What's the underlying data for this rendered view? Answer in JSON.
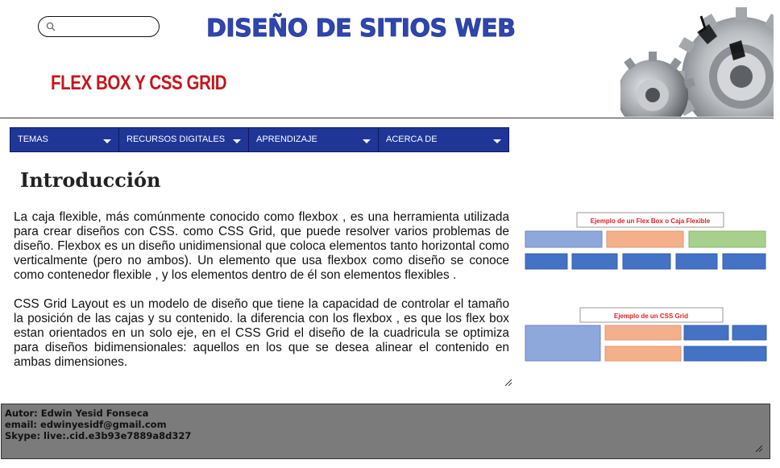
{
  "header": {
    "search": {
      "placeholder": ""
    },
    "site_title": "DISEÑO DE SITIOS WEB",
    "subtitle": "FLEX BOX Y CSS GRID",
    "banner_image": "gears-image"
  },
  "nav": {
    "items": [
      {
        "label": "TEMAS"
      },
      {
        "label": "RECURSOS DIGITALES"
      },
      {
        "label": "APRENDIZAJE"
      },
      {
        "label": "ACERCA DE"
      }
    ]
  },
  "main": {
    "title": "Introducción",
    "paragraphs": [
      "La caja flexible, más comúnmente conocido como flexbox , es una herramienta utilizada para crear diseños con CSS. como CSS Grid, que puede resolver varios problemas de diseño. Flexbox es un diseño unidimensional que coloca elementos tanto horizontal como verticalmente (pero no ambos). Un elemento que usa flexbox como diseño se conoce como contenedor flexible , y los elementos dentro de él son elementos flexibles .",
      "CSS Grid Layout es un modelo de diseño que tiene la capacidad de controlar el tamaño la posición de las cajas y su contenido. la diferencia con los flexbox , es que los flex box estan orientados en un solo eje, en el CSS Grid el diseño de la cuadricula se optimiza para diseños bidimensionales: aquellos en los que se desea alinear el contenido en ambas dimensiones."
    ],
    "figure": {
      "flex_caption": "Ejemplo de un Flex Box o Caja Flexible",
      "grid_caption": "Ejemplo de un CSS Grid"
    }
  },
  "footer": {
    "author": "Autor: Edwin Yesid Fonseca",
    "email": "email: edwinyesidf@gmail.com",
    "skype": "Skype: live:.cid.e3b93e7889a8d327"
  },
  "colors": {
    "nav_bg": "#1f3697",
    "title_blue": "#2f45b0",
    "subtitle_red": "#c4161c",
    "footer_bg": "#7b7b7b"
  }
}
